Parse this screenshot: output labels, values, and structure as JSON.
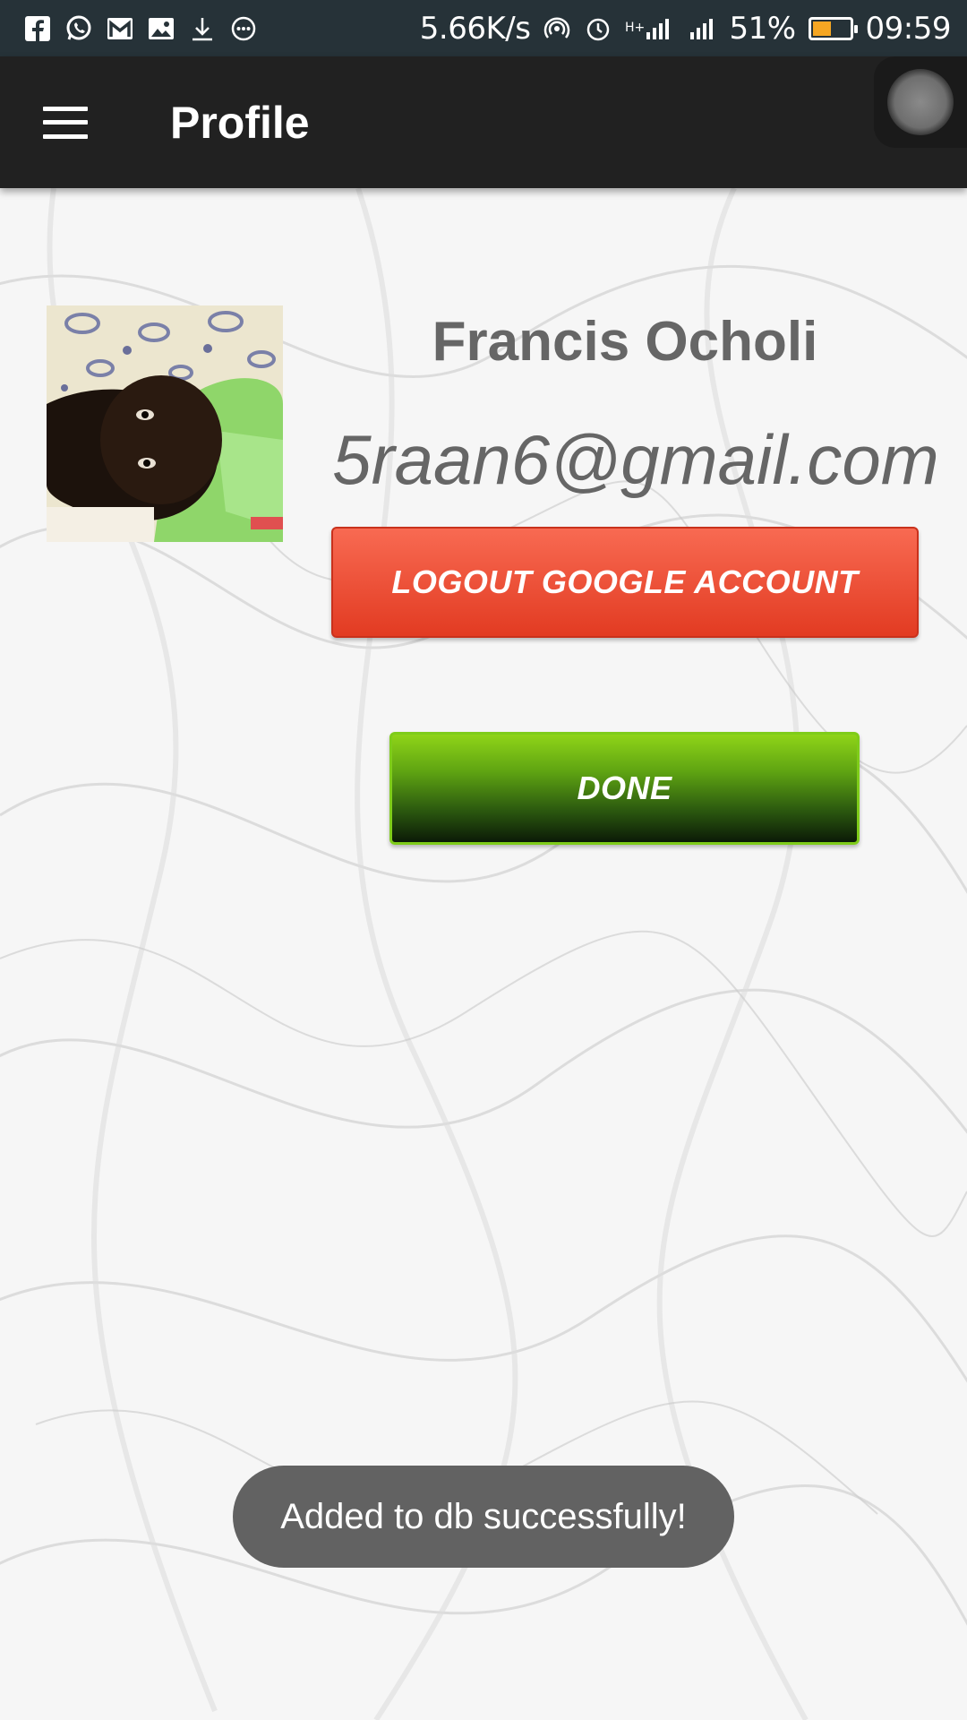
{
  "status_bar": {
    "icons_left": [
      "facebook-icon",
      "whatsapp-icon",
      "gmail-icon",
      "gallery-icon",
      "download-icon",
      "more-icon"
    ],
    "network_speed": "5.66K/s",
    "battery_percent": "51%",
    "battery_level": 0.51,
    "time": "09:59",
    "icons_right": [
      "hotspot-icon",
      "alarm-icon",
      "h-plus-signal-icon",
      "signal-icon",
      "battery-icon"
    ]
  },
  "app_bar": {
    "title": "Profile",
    "menu_icon": "hamburger-menu-icon"
  },
  "profile": {
    "name": "Francis Ocholi",
    "email": "5raan6@gmail.com"
  },
  "buttons": {
    "logout_label": "LOGOUT GOOGLE ACCOUNT",
    "done_label": "DONE"
  },
  "toast": {
    "message": "Added to db successfully!"
  },
  "colors": {
    "status_bar_bg": "#263238",
    "app_bar_bg": "#212121",
    "logout_red": "#e23b22",
    "done_green": "#7fcc1a",
    "toast_bg": "#626262"
  }
}
